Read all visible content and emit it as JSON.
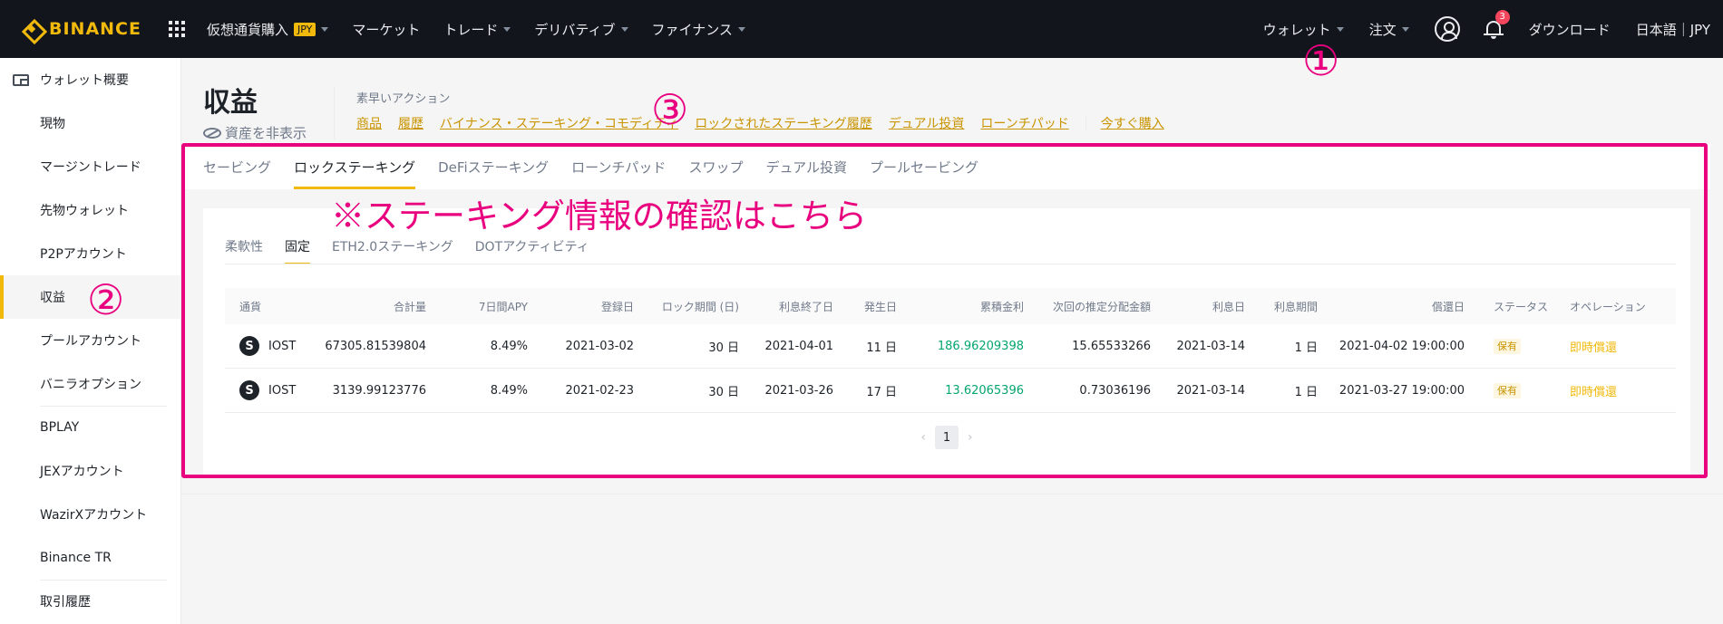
{
  "brand": {
    "name": "BINANCE",
    "color": "#f0b90b"
  },
  "topnav": {
    "items": [
      {
        "label": "仮想通貨購入",
        "badge": "JPY",
        "caret": true
      },
      {
        "label": "マーケット",
        "caret": false
      },
      {
        "label": "トレード",
        "caret": true
      },
      {
        "label": "デリバティブ",
        "caret": true
      },
      {
        "label": "ファイナンス",
        "caret": true
      }
    ],
    "right": {
      "wallet": "ウォレット",
      "orders": "注文",
      "notifications": "3",
      "download": "ダウンロード",
      "language": "日本語｜JPY"
    }
  },
  "sidebar": {
    "items": [
      {
        "label": "ウォレット概要",
        "icon": "wallet-icon"
      },
      {
        "label": "現物"
      },
      {
        "label": "マージントレード"
      },
      {
        "label": "先物ウォレット"
      },
      {
        "label": "P2Pアカウント"
      },
      {
        "label": "収益",
        "active": true
      },
      {
        "label": "プールアカウント"
      },
      {
        "label": "バニラオプション"
      },
      {
        "label": "BPLAY"
      },
      {
        "label": "JEXアカウント"
      },
      {
        "label": "WazirXアカウント"
      },
      {
        "label": "Binance TR"
      },
      {
        "label": "取引履歴"
      }
    ]
  },
  "header": {
    "title": "収益",
    "hide_assets": "資産を非表示",
    "quick_label": "素早いアクション",
    "quick_links": [
      "商品",
      "履歴",
      "バイナンス・ステーキング・コモディティ",
      "ロックされたステーキング履歴",
      "デュアル投資",
      "ローンチパッド"
    ],
    "buy_now": "今すぐ購入"
  },
  "tabs": [
    "セービング",
    "ロックステーキング",
    "DeFiステーキング",
    "ローンチパッド",
    "スワップ",
    "デュアル投資",
    "プールセービング"
  ],
  "active_tab": 1,
  "subtabs": [
    "柔軟性",
    "固定",
    "ETH2.0ステーキング",
    "DOTアクティビティ"
  ],
  "active_subtab": 1,
  "table": {
    "columns": [
      "通貨",
      "合計量",
      "7日間APY",
      "登録日",
      "ロック期間 (日)",
      "利息終了日",
      "発生日",
      "累積金利",
      "次回の推定分配金額",
      "利息日",
      "利息期間",
      "償還日",
      "ステータス",
      "オペレーション"
    ],
    "rows": [
      [
        "IOST",
        "67305.81539804",
        "8.49%",
        "2021-03-02",
        "30 日",
        "2021-04-01",
        "11 日",
        "186.96209398",
        "15.65533266",
        "2021-03-14",
        "1 日",
        "2021-04-02 19:00:00",
        "保有",
        "即時償還"
      ],
      [
        "IOST",
        "3139.99123776",
        "8.49%",
        "2021-02-23",
        "30 日",
        "2021-03-26",
        "17 日",
        "13.62065396",
        "0.73036196",
        "2021-03-14",
        "1 日",
        "2021-03-27 19:00:00",
        "保有",
        "即時償還"
      ]
    ]
  },
  "pager": {
    "current": "1"
  },
  "annotations": {
    "marker1": "①",
    "marker2": "②",
    "marker3": "③",
    "note": "※ステーキング情報の確認はこちら",
    "color": "#e8007f"
  }
}
